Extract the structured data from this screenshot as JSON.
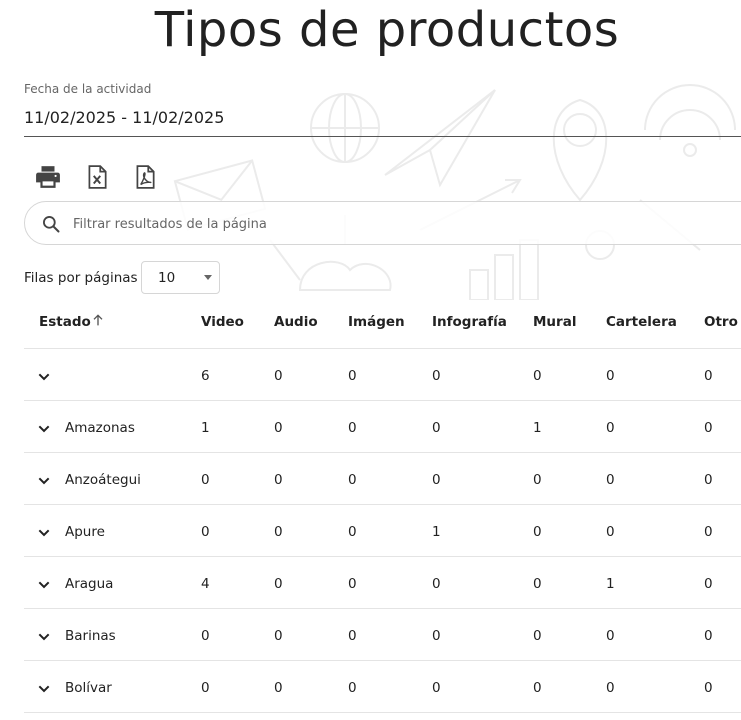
{
  "page": {
    "title": "Tipos de productos"
  },
  "date_filter": {
    "label": "Fecha de la actividad",
    "value": "11/02/2025 - 11/02/2025"
  },
  "toolbar": {
    "icons": [
      "print-icon",
      "excel-icon",
      "pdf-icon"
    ]
  },
  "search": {
    "placeholder": "Filtrar resultados de la página",
    "value": ""
  },
  "pagination": {
    "rows_label": "Filas por páginas",
    "rows_value": "10"
  },
  "table": {
    "columns": [
      "Estado",
      "Video",
      "Audio",
      "Imágen",
      "Infografía",
      "Mural",
      "Cartelera",
      "Otro"
    ],
    "sort": {
      "column": "Estado",
      "direction": "ascending",
      "icon": "arrow-up-icon"
    },
    "rows": [
      {
        "estado": "",
        "values": [
          "6",
          "0",
          "0",
          "0",
          "0",
          "0",
          "0"
        ]
      },
      {
        "estado": "Amazonas",
        "values": [
          "1",
          "0",
          "0",
          "0",
          "1",
          "0",
          "0"
        ]
      },
      {
        "estado": "Anzoátegui",
        "values": [
          "0",
          "0",
          "0",
          "0",
          "0",
          "0",
          "0"
        ]
      },
      {
        "estado": "Apure",
        "values": [
          "0",
          "0",
          "0",
          "1",
          "0",
          "0",
          "0"
        ]
      },
      {
        "estado": "Aragua",
        "values": [
          "4",
          "0",
          "0",
          "0",
          "0",
          "1",
          "0"
        ]
      },
      {
        "estado": "Barinas",
        "values": [
          "0",
          "0",
          "0",
          "0",
          "0",
          "0",
          "0"
        ]
      },
      {
        "estado": "Bolívar",
        "values": [
          "0",
          "0",
          "0",
          "0",
          "0",
          "0",
          "0"
        ]
      }
    ]
  }
}
